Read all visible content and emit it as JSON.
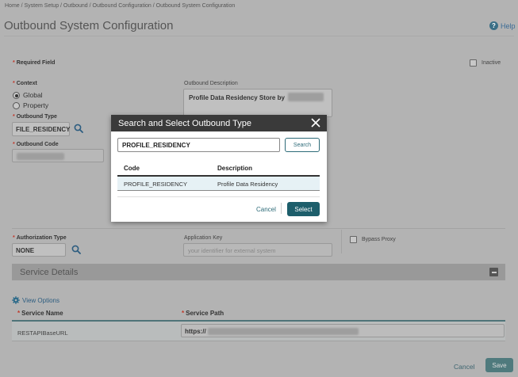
{
  "breadcrumb": "Home / System Setup / Outbound / Outbound Configuration / Outbound System Configuration",
  "page_title": "Outbound System Configuration",
  "help_label": "Help",
  "required_field": "Required Field",
  "inactive_label": "Inactive",
  "context": {
    "label": "Context",
    "options": [
      "Global",
      "Property"
    ],
    "selected": "Global"
  },
  "outbound_description": {
    "label": "Outbound Description",
    "value": "Profile Data Residency Store by"
  },
  "outbound_type": {
    "label": "Outbound Type",
    "value": "FILE_RESIDENCY"
  },
  "outbound_code": {
    "label": "Outbound Code"
  },
  "authorization_type": {
    "label": "Authorization Type",
    "value": "NONE"
  },
  "application_key": {
    "label": "Application Key",
    "placeholder": "your identifier for external system"
  },
  "bypass_proxy_label": "Bypass Proxy",
  "service_details": {
    "title": "Service Details",
    "view_options": "View Options",
    "columns": [
      "Service Name",
      "Service Path"
    ],
    "rows": [
      {
        "name": "RESTAPIBaseURL",
        "path": "https://"
      }
    ]
  },
  "footer": {
    "cancel": "Cancel",
    "save": "Save"
  },
  "dialog": {
    "title": "Search and Select Outbound Type",
    "search_value": "PROFILE_RESIDENCY",
    "search_button": "Search",
    "columns": [
      "Code",
      "Description"
    ],
    "rows": [
      {
        "code": "PROFILE_RESIDENCY",
        "description": "Profile Data Residency"
      }
    ],
    "cancel": "Cancel",
    "select": "Select"
  },
  "icons": {
    "help": "help-icon",
    "search": "magnifier-icon",
    "close": "close-icon",
    "view_options": "gear-icon",
    "collapse": "minus-icon"
  },
  "colors": {
    "accent": "#1d5e6b",
    "dialog_header": "#3a3a3a",
    "required": "#c0392b",
    "selected_row": "#e6f1f5"
  }
}
